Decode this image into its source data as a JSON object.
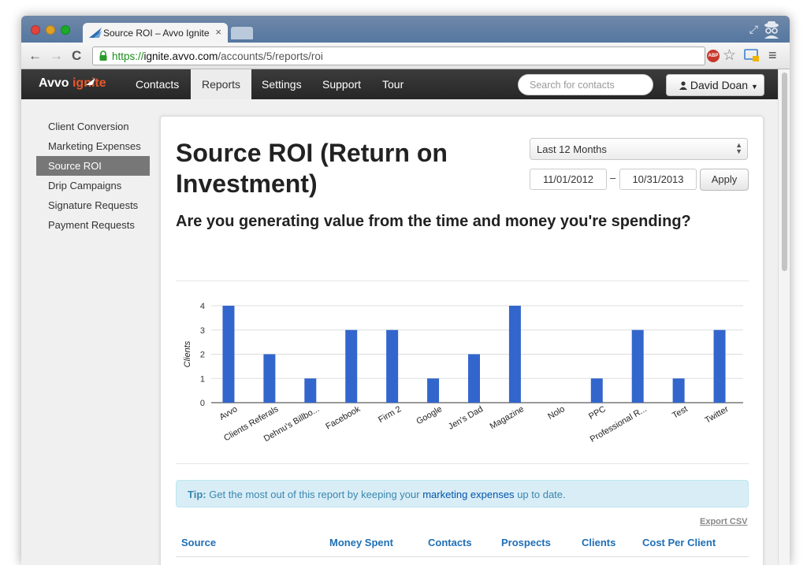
{
  "browser": {
    "tab_title": "Source ROI – Avvo Ignite",
    "tab_close": "×",
    "url_scheme": "https://",
    "url_host": "ignite.avvo.com",
    "url_path": "/accounts/5/reports/roi",
    "abp_label": "ABP",
    "back_glyph": "←",
    "forward_glyph": "→",
    "reload_glyph": "C",
    "star_glyph": "☆",
    "menu_glyph": "≡",
    "resize_glyph": "⤢"
  },
  "app": {
    "logo_avvo": "Avvo",
    "logo_ignite": "ignite",
    "nav": [
      "Contacts",
      "Reports",
      "Settings",
      "Support",
      "Tour"
    ],
    "search_placeholder": "Search for contacts",
    "user_name": "David Doan"
  },
  "sidebar": {
    "items": [
      "Client Conversion",
      "Marketing Expenses",
      "Source ROI",
      "Drip Campaigns",
      "Signature Requests",
      "Payment Requests"
    ]
  },
  "page": {
    "title": "Source ROI (Return on Investment)",
    "range_label": "Last 12 Months",
    "date_from": "11/01/2012",
    "date_sep": "–",
    "date_to": "10/31/2013",
    "apply_label": "Apply",
    "subtitle": "Are you generating value from the time and money you're spending?",
    "tip_bold": "Tip:",
    "tip_text_before": "Get the most out of this report by keeping your",
    "tip_link": "marketing expenses",
    "tip_text_after": "up to date.",
    "export_label": "Export CSV",
    "table_headers": [
      "Source",
      "Money Spent",
      "Contacts",
      "Prospects",
      "Clients",
      "Cost Per Client"
    ]
  },
  "colors": {
    "bar": "#3366cc",
    "nav_bg": "#2c2c2c",
    "accent": "#e8572a",
    "link": "#1f6fb5"
  },
  "chart_data": {
    "type": "bar",
    "categories": [
      "Avvo",
      "Clients Referals",
      "Dehnu's Billbo...",
      "Facebook",
      "Firm 2",
      "Google",
      "Jen's Dad",
      "Magazine",
      "Nolo",
      "PPC",
      "Professional R...",
      "Test",
      "Twitter"
    ],
    "values": [
      4,
      2,
      1,
      3,
      3,
      1,
      2,
      4,
      0,
      1,
      3,
      1,
      3
    ],
    "title": "",
    "xlabel": "",
    "ylabel": "Clients",
    "ylim": [
      0,
      4
    ],
    "yticks": [
      0,
      1,
      2,
      3,
      4
    ],
    "grid": true,
    "legend": "none"
  }
}
